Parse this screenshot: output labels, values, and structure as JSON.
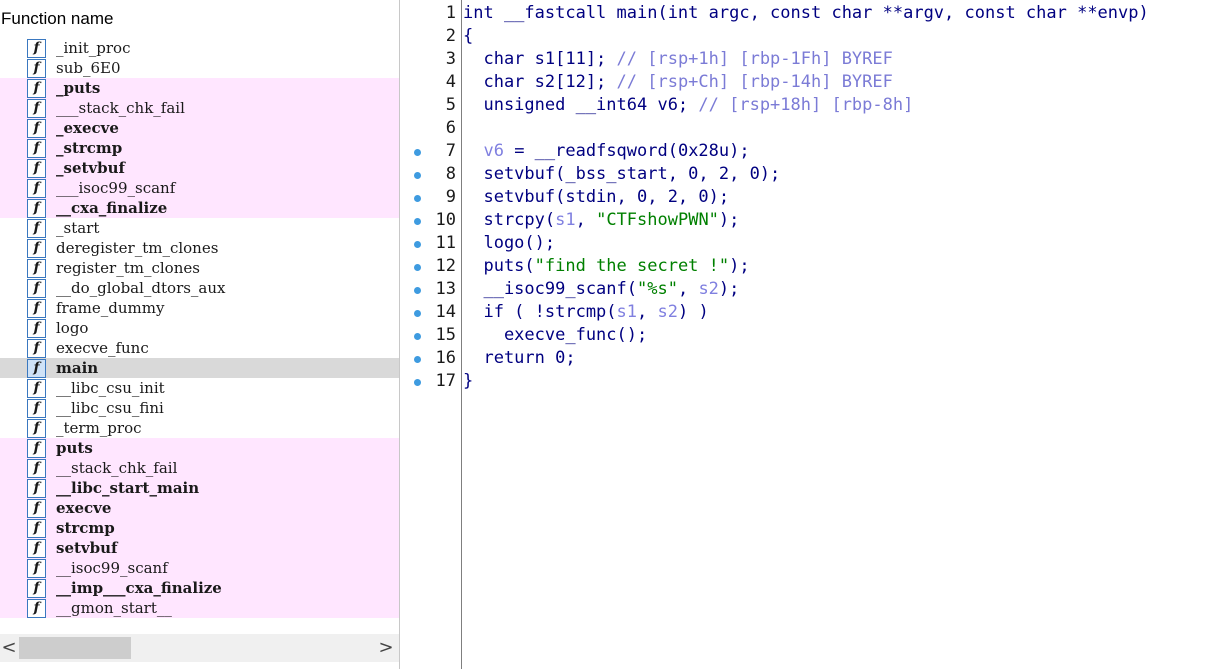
{
  "functions_pane": {
    "header": "Function name",
    "items": [
      {
        "name": "_init_proc",
        "lib": false,
        "bold": false,
        "selected": false
      },
      {
        "name": "sub_6E0",
        "lib": false,
        "bold": false,
        "selected": false
      },
      {
        "name": "_puts",
        "lib": true,
        "bold": true,
        "selected": false
      },
      {
        "name": "___stack_chk_fail",
        "lib": true,
        "bold": false,
        "selected": false
      },
      {
        "name": "_execve",
        "lib": true,
        "bold": true,
        "selected": false
      },
      {
        "name": "_strcmp",
        "lib": true,
        "bold": true,
        "selected": false
      },
      {
        "name": "_setvbuf",
        "lib": true,
        "bold": true,
        "selected": false
      },
      {
        "name": "___isoc99_scanf",
        "lib": true,
        "bold": false,
        "selected": false
      },
      {
        "name": "__cxa_finalize",
        "lib": true,
        "bold": true,
        "selected": false
      },
      {
        "name": "_start",
        "lib": false,
        "bold": false,
        "selected": false
      },
      {
        "name": "deregister_tm_clones",
        "lib": false,
        "bold": false,
        "selected": false
      },
      {
        "name": "register_tm_clones",
        "lib": false,
        "bold": false,
        "selected": false
      },
      {
        "name": "__do_global_dtors_aux",
        "lib": false,
        "bold": false,
        "selected": false
      },
      {
        "name": "frame_dummy",
        "lib": false,
        "bold": false,
        "selected": false
      },
      {
        "name": "logo",
        "lib": false,
        "bold": false,
        "selected": false
      },
      {
        "name": "execve_func",
        "lib": false,
        "bold": false,
        "selected": false
      },
      {
        "name": "main",
        "lib": false,
        "bold": true,
        "selected": true
      },
      {
        "name": "__libc_csu_init",
        "lib": false,
        "bold": false,
        "selected": false
      },
      {
        "name": "__libc_csu_fini",
        "lib": false,
        "bold": false,
        "selected": false
      },
      {
        "name": "_term_proc",
        "lib": false,
        "bold": false,
        "selected": false
      },
      {
        "name": "puts",
        "lib": true,
        "bold": true,
        "selected": false
      },
      {
        "name": "__stack_chk_fail",
        "lib": true,
        "bold": false,
        "selected": false
      },
      {
        "name": "__libc_start_main",
        "lib": true,
        "bold": true,
        "selected": false
      },
      {
        "name": "execve",
        "lib": true,
        "bold": true,
        "selected": false
      },
      {
        "name": "strcmp",
        "lib": true,
        "bold": true,
        "selected": false
      },
      {
        "name": "setvbuf",
        "lib": true,
        "bold": true,
        "selected": false
      },
      {
        "name": "__isoc99_scanf",
        "lib": true,
        "bold": false,
        "selected": false
      },
      {
        "name": "__imp___cxa_finalize",
        "lib": true,
        "bold": true,
        "selected": false
      },
      {
        "name": "__gmon_start__",
        "lib": true,
        "bold": false,
        "selected": false
      }
    ],
    "icon_glyph": "f",
    "scroll_left_glyph": "<",
    "scroll_right_glyph": ">"
  },
  "pseudocode": {
    "lines": [
      {
        "num": "1",
        "breakpoint": false,
        "segments": [
          {
            "t": "int __fastcall main(int argc, const char **argv, const char **envp)",
            "c": "code"
          }
        ]
      },
      {
        "num": "2",
        "breakpoint": false,
        "segments": [
          {
            "t": "{",
            "c": "code"
          }
        ]
      },
      {
        "num": "3",
        "breakpoint": false,
        "segments": [
          {
            "t": "  char s1[11]; ",
            "c": "code"
          },
          {
            "t": "// [rsp+1h] [rbp-1Fh] BYREF",
            "c": "cmt"
          }
        ]
      },
      {
        "num": "4",
        "breakpoint": false,
        "segments": [
          {
            "t": "  char s2[12]; ",
            "c": "code"
          },
          {
            "t": "// [rsp+Ch] [rbp-14h] BYREF",
            "c": "cmt"
          }
        ]
      },
      {
        "num": "5",
        "breakpoint": false,
        "segments": [
          {
            "t": "  unsigned __int64 v6; ",
            "c": "code"
          },
          {
            "t": "// [rsp+18h] [rbp-8h]",
            "c": "cmt"
          }
        ]
      },
      {
        "num": "6",
        "breakpoint": false,
        "segments": [
          {
            "t": "",
            "c": "code"
          }
        ]
      },
      {
        "num": "7",
        "breakpoint": true,
        "segments": [
          {
            "t": "  ",
            "c": "code"
          },
          {
            "t": "v6",
            "c": "var"
          },
          {
            "t": " = __readfsqword(0x28u);",
            "c": "code"
          }
        ]
      },
      {
        "num": "8",
        "breakpoint": true,
        "segments": [
          {
            "t": "  setvbuf(_bss_start, 0, 2, 0);",
            "c": "code"
          }
        ]
      },
      {
        "num": "9",
        "breakpoint": true,
        "segments": [
          {
            "t": "  setvbuf(stdin, 0, 2, 0);",
            "c": "code"
          }
        ]
      },
      {
        "num": "10",
        "breakpoint": true,
        "segments": [
          {
            "t": "  strcpy(",
            "c": "code"
          },
          {
            "t": "s1",
            "c": "var"
          },
          {
            "t": ", ",
            "c": "code"
          },
          {
            "t": "\"CTFshowPWN\"",
            "c": "str"
          },
          {
            "t": ");",
            "c": "code"
          }
        ]
      },
      {
        "num": "11",
        "breakpoint": true,
        "segments": [
          {
            "t": "  logo();",
            "c": "code"
          }
        ]
      },
      {
        "num": "12",
        "breakpoint": true,
        "segments": [
          {
            "t": "  puts(",
            "c": "code"
          },
          {
            "t": "\"find the secret !\"",
            "c": "str"
          },
          {
            "t": ");",
            "c": "code"
          }
        ]
      },
      {
        "num": "13",
        "breakpoint": true,
        "segments": [
          {
            "t": "  __isoc99_scanf(",
            "c": "code"
          },
          {
            "t": "\"%s\"",
            "c": "str"
          },
          {
            "t": ", ",
            "c": "code"
          },
          {
            "t": "s2",
            "c": "var"
          },
          {
            "t": ");",
            "c": "code"
          }
        ]
      },
      {
        "num": "14",
        "breakpoint": true,
        "segments": [
          {
            "t": "  if ( !strcmp(",
            "c": "code"
          },
          {
            "t": "s1",
            "c": "var"
          },
          {
            "t": ", ",
            "c": "code"
          },
          {
            "t": "s2",
            "c": "var"
          },
          {
            "t": ") )",
            "c": "code"
          }
        ]
      },
      {
        "num": "15",
        "breakpoint": true,
        "segments": [
          {
            "t": "    execve_func();",
            "c": "code"
          }
        ]
      },
      {
        "num": "16",
        "breakpoint": true,
        "segments": [
          {
            "t": "  return 0;",
            "c": "code"
          }
        ]
      },
      {
        "num": "17",
        "breakpoint": true,
        "segments": [
          {
            "t": "}",
            "c": "code"
          }
        ]
      }
    ]
  },
  "colors": {
    "lib_function_bg": "#ffe6ff",
    "selected_bg": "#d9d9d9",
    "code_text": "#000080",
    "comment": "#7b7bd6",
    "variable": "#8080e0",
    "string": "#008000",
    "breakpoint_dot": "#3e9be0"
  }
}
